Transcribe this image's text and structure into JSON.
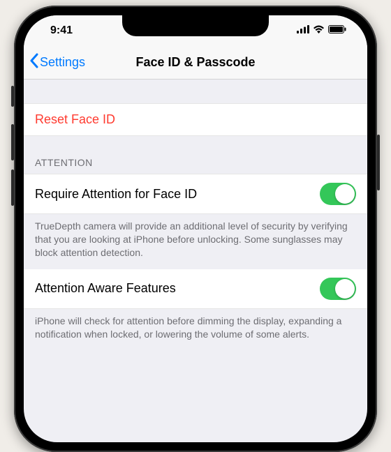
{
  "status": {
    "time": "9:41"
  },
  "nav": {
    "back_label": "Settings",
    "title": "Face ID & Passcode"
  },
  "reset": {
    "label": "Reset Face ID"
  },
  "attention": {
    "header": "ATTENTION",
    "require": {
      "label": "Require Attention for Face ID",
      "on": true
    },
    "require_footer": "TrueDepth camera will provide an additional level of security by verifying that you are looking at iPhone before unlocking. Some sunglasses may block attention detection.",
    "aware": {
      "label": "Attention Aware Features",
      "on": true
    },
    "aware_footer": "iPhone will check for attention before dimming the display, expanding a notification when locked, or lowering the volume of some alerts."
  }
}
